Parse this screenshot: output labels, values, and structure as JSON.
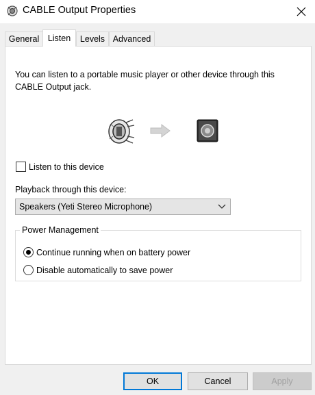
{
  "window": {
    "title": "CABLE Output Properties",
    "title_icon": "speaker-device-icon",
    "close_icon": "close-icon"
  },
  "tabs": [
    {
      "label": "General",
      "active": false
    },
    {
      "label": "Listen",
      "active": true
    },
    {
      "label": "Levels",
      "active": false
    },
    {
      "label": "Advanced",
      "active": false
    }
  ],
  "listen": {
    "description_line1": "You can listen to a portable music player or other device through this",
    "description_line2": "CABLE Output jack.",
    "source_icon": "cable-jack-icon",
    "arrow_icon": "arrow-right-icon",
    "target_icon": "speaker-icon",
    "listen_checkbox_label": "Listen to this device",
    "listen_checked": false,
    "playback_label": "Playback through this device:",
    "playback_device": "Speakers (Yeti Stereo Microphone)"
  },
  "power": {
    "legend": "Power Management",
    "options": [
      {
        "label": "Continue running when on battery power",
        "checked": true
      },
      {
        "label": "Disable automatically to save power",
        "checked": false
      }
    ]
  },
  "buttons": {
    "ok": "OK",
    "cancel": "Cancel",
    "apply": "Apply"
  },
  "colors": {
    "accent": "#0078d7",
    "panel_bg": "#ffffff",
    "window_bg": "#f0f0f0"
  }
}
